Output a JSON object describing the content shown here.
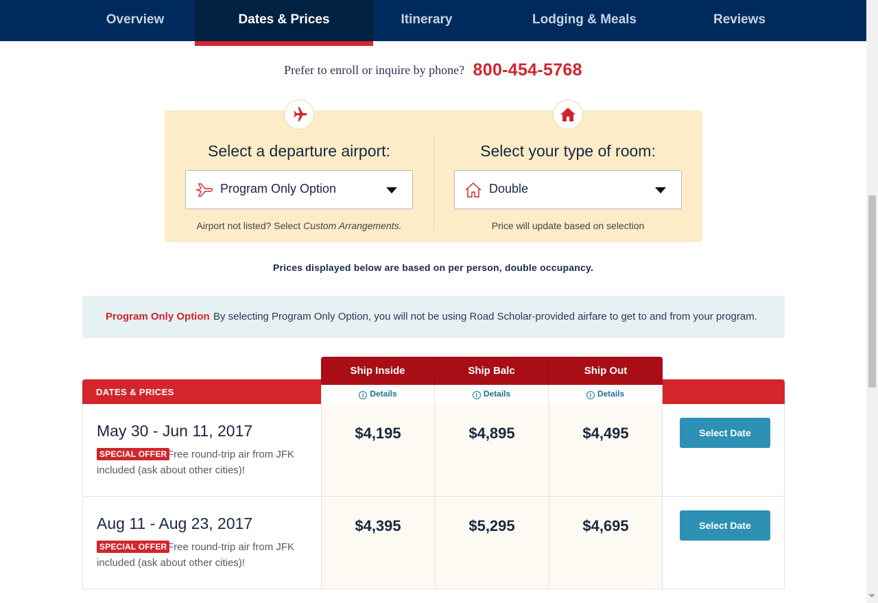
{
  "nav": {
    "tabs": [
      {
        "label": "Overview"
      },
      {
        "label": "Dates & Prices"
      },
      {
        "label": "Itinerary"
      },
      {
        "label": "Lodging & Meals"
      },
      {
        "label": "Reviews"
      }
    ],
    "active_tab": "Dates & Prices"
  },
  "phone": {
    "prompt": "Prefer to enroll or inquire by phone?",
    "number": "800-454-5768"
  },
  "selectors": {
    "airport": {
      "title": "Select a departure airport:",
      "value": "Program Only Option",
      "note_prefix": "Airport not listed? Select ",
      "note_emphasis": "Custom Arrangements."
    },
    "room": {
      "title": "Select your type of room:",
      "value": "Double",
      "note": "Price will update based on selection"
    }
  },
  "occupancy_note": "Prices displayed below are based on per person, double occupancy.",
  "info_banner": {
    "label": "Program Only Option",
    "text": "By selecting Program Only Option, you will not be using Road Scholar-provided airfare to get to and from your program."
  },
  "table": {
    "section_label": "DATES & PRICES",
    "room_types": [
      {
        "name": "Ship Inside",
        "details": "Details"
      },
      {
        "name": "Ship Balc",
        "details": "Details"
      },
      {
        "name": "Ship Out",
        "details": "Details"
      }
    ],
    "rows": [
      {
        "dates": "May 30 - Jun 11, 2017",
        "offer_badge": "SPECIAL OFFER",
        "offer_text": "Free round-trip air from JFK included (ask about other cities)!",
        "prices": [
          "$4,195",
          "$4,895",
          "$4,495"
        ],
        "button": "Select Date"
      },
      {
        "dates": "Aug 11 - Aug 23, 2017",
        "offer_badge": "SPECIAL OFFER",
        "offer_text": "Free round-trip air from JFK included (ask about other cities)!",
        "prices": [
          "$4,395",
          "$5,295",
          "$4,695"
        ],
        "button": "Select Date"
      }
    ]
  },
  "icons": {
    "airport": "airplane-icon",
    "room": "house-icon",
    "details": "info-icon"
  },
  "colors": {
    "nav_bg": "#002a5c",
    "accent_red": "#d0262d",
    "header_red": "#a90e17",
    "panel_bg": "#fcecc8",
    "button_blue": "#2c91b4"
  }
}
